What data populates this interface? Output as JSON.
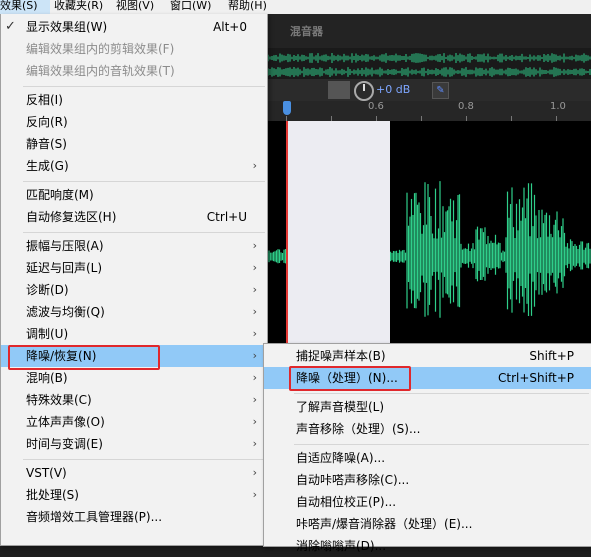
{
  "menubar": {
    "items": [
      "效果(S)",
      "收藏夹(R)",
      "视图(V)",
      "窗口(W)",
      "帮助(H)"
    ]
  },
  "editor": {
    "mixer_title": "混音器",
    "volume": "+0 dB",
    "ruler_labels": [
      "0.6",
      "0.8",
      "1.0"
    ]
  },
  "main_menu": {
    "items": [
      {
        "label": "显示效果组(W)",
        "shortcut": "Alt+0",
        "checked": true
      },
      {
        "label": "编辑效果组内的剪辑效果(F)",
        "disabled": true
      },
      {
        "label": "编辑效果组内的音轨效果(T)",
        "disabled": true
      },
      {
        "label": "反相(I)"
      },
      {
        "label": "反向(R)"
      },
      {
        "label": "静音(S)"
      },
      {
        "label": "生成(G)",
        "submenu": true
      },
      {
        "label": "匹配响度(M)"
      },
      {
        "label": "自动修复选区(H)",
        "shortcut": "Ctrl+U"
      },
      {
        "label": "振幅与压限(A)",
        "submenu": true
      },
      {
        "label": "延迟与回声(L)",
        "submenu": true
      },
      {
        "label": "诊断(D)",
        "submenu": true
      },
      {
        "label": "滤波与均衡(Q)",
        "submenu": true
      },
      {
        "label": "调制(U)",
        "submenu": true
      },
      {
        "label": "降噪/恢复(N)",
        "submenu": true,
        "highlighted": true
      },
      {
        "label": "混响(B)",
        "submenu": true
      },
      {
        "label": "特殊效果(C)",
        "submenu": true
      },
      {
        "label": "立体声声像(O)",
        "submenu": true
      },
      {
        "label": "时间与变调(E)",
        "submenu": true
      },
      {
        "label": "VST(V)",
        "submenu": true
      },
      {
        "label": "批处理(S)",
        "submenu": true
      },
      {
        "label": "音频增效工具管理器(P)..."
      }
    ]
  },
  "sub_menu": {
    "items": [
      {
        "label": "捕捉噪声样本(B)",
        "shortcut": "Shift+P"
      },
      {
        "label": "降噪（处理）(N)...",
        "shortcut": "Ctrl+Shift+P",
        "highlighted": true
      },
      {
        "label": "了解声音模型(L)"
      },
      {
        "label": "声音移除（处理）(S)..."
      },
      {
        "label": "自适应降噪(A)..."
      },
      {
        "label": "自动咔嗒声移除(C)..."
      },
      {
        "label": "自动相位校正(P)..."
      },
      {
        "label": "咔嗒声/爆音消除器（处理）(E)..."
      },
      {
        "label": "消除嗡嗡声(D)..."
      }
    ]
  },
  "colors": {
    "waveform": "#2fcf8a",
    "highlight": "#91c9f7",
    "annotation_box": "#e0282c"
  }
}
